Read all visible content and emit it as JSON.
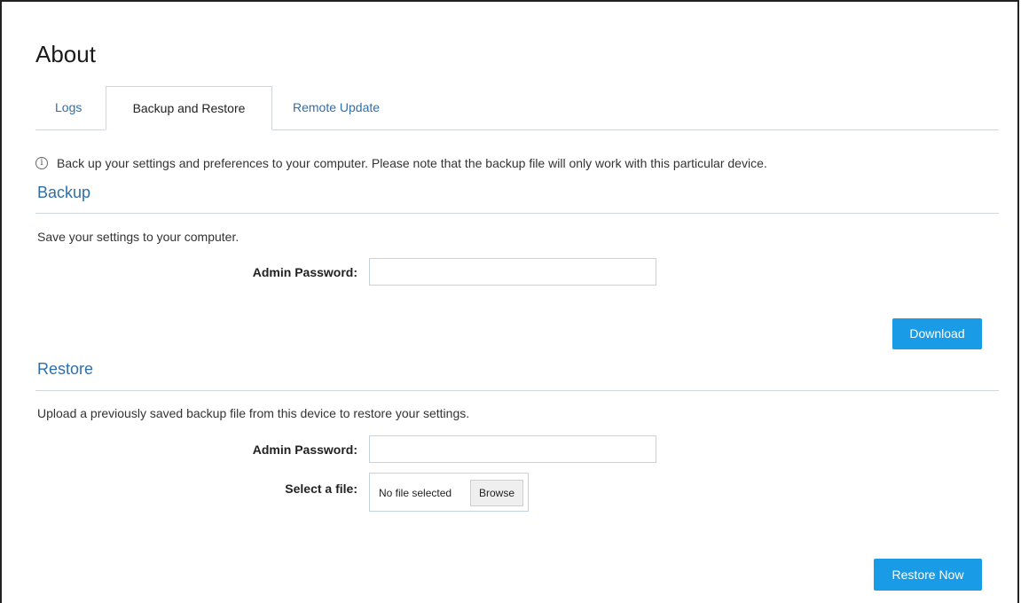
{
  "page": {
    "title": "About"
  },
  "tabs": [
    {
      "label": "Logs",
      "active": false
    },
    {
      "label": "Backup and Restore",
      "active": true
    },
    {
      "label": "Remote Update",
      "active": false
    }
  ],
  "info": {
    "icon": "info-icon",
    "text": "Back up your settings and preferences to your computer. Please note that the backup file will only work with this particular device."
  },
  "backup": {
    "title": "Backup",
    "description": "Save your settings to your computer.",
    "password_label": "Admin Password:",
    "password_value": "",
    "download_label": "Download"
  },
  "restore": {
    "title": "Restore",
    "description": "Upload a previously saved backup file from this device to restore your settings.",
    "password_label": "Admin Password:",
    "password_value": "",
    "file_label": "Select a file:",
    "file_status": "No file selected",
    "browse_label": "Browse",
    "restore_label": "Restore Now"
  },
  "colors": {
    "accent": "#2f6fa8",
    "button": "#1a9be6",
    "border": "#cfd6de"
  }
}
